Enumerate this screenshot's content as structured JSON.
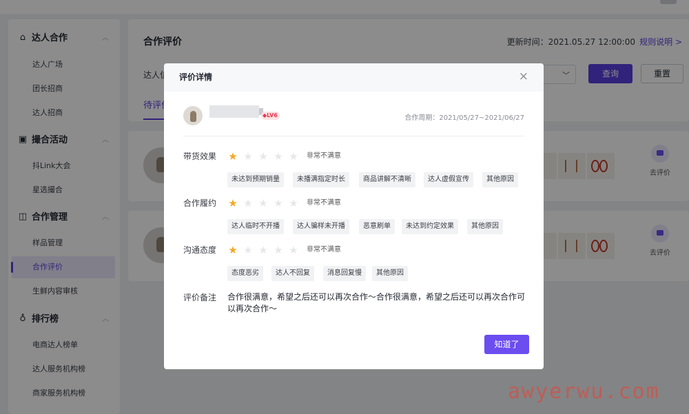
{
  "sidebar": {
    "groups": [
      {
        "icon": "handshake-icon",
        "title": "达人合作",
        "items": [
          "达人广场",
          "团长招商",
          "达人招商"
        ]
      },
      {
        "icon": "activity-icon",
        "title": "撮合活动",
        "items": [
          "抖Link大会",
          "星选撮合"
        ]
      },
      {
        "icon": "management-icon",
        "title": "合作管理",
        "items": [
          "样品管理",
          "合作评价",
          "生鲜内容审核"
        ]
      },
      {
        "icon": "trophy-icon",
        "title": "排行榜",
        "items": [
          "电商达人榜单",
          "达人服务机构榜",
          "商家服务机构榜"
        ]
      }
    ],
    "active_item": "合作评价"
  },
  "main": {
    "title": "合作评价",
    "update_time": "更新时间：2021.05.27 12:00:00",
    "rules_link": "规则说明 >",
    "filter_label": "达人信",
    "query_button": "查询",
    "reset_button": "重置",
    "active_tab": "待评价",
    "rows": [
      {
        "action_label": "去评价"
      },
      {
        "action_label": "去评价"
      }
    ]
  },
  "modal": {
    "title": "评价详情",
    "close_icon": "×",
    "level_badge": "LV6",
    "cooperation_period": "合作周期：2021/05/27~2021/06/27",
    "criteria": [
      {
        "label": "带货效果",
        "stars": 1,
        "max_stars": 5,
        "rating_text": "非常不满意",
        "tags": [
          "未达到预期销量",
          "未播满指定时长",
          "商品讲解不清晰",
          "达人虚假宣传",
          "其他原因"
        ]
      },
      {
        "label": "合作履约",
        "stars": 1,
        "max_stars": 5,
        "rating_text": "非常不满意",
        "tags": [
          "达人临时不开播",
          "达人骗样未开播",
          "恶意刷单",
          "未达到约定效果",
          "其他原因"
        ]
      },
      {
        "label": "沟通态度",
        "stars": 1,
        "max_stars": 5,
        "rating_text": "非常不满意",
        "tags": [
          "态度恶劣",
          "达人不回复",
          "消息回复慢",
          "其他原因"
        ]
      }
    ],
    "remark_label": "评价备注",
    "remark_text": "合作很满意，希望之后还可以再次合作～合作很满意，希望之后还可以再次合作可以再次合作～",
    "ok_button": "知道了"
  },
  "watermark": "awyerwu.com",
  "colors": {
    "accent": "#5a3ee0",
    "star_on": "#f5a623",
    "badge": "#e5374f"
  }
}
